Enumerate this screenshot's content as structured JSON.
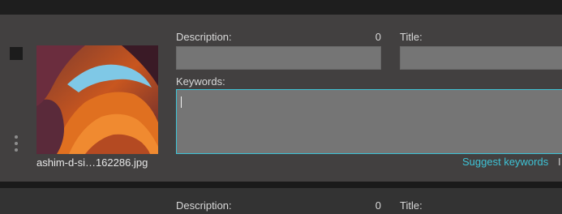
{
  "items": [
    {
      "filename": "ashim-d-si…162286.jpg",
      "description_label": "Description:",
      "description_count": "0",
      "title_label": "Title:",
      "keywords_label": "Keywords:",
      "suggest_label": "Suggest keywords",
      "overflow_text": "I"
    },
    {
      "description_label": "Description:",
      "description_count": "0",
      "title_label": "Title:"
    }
  ],
  "colors": {
    "accent": "#3ec3d6",
    "panel": "#424040",
    "field": "#757575"
  },
  "icons": {
    "menu": "vertical-dots-icon",
    "select": "checkbox-icon"
  }
}
